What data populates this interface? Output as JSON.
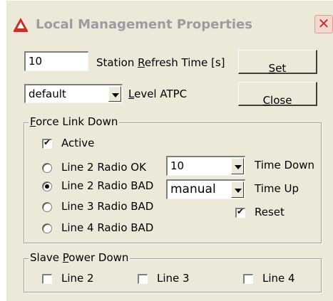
{
  "window": {
    "title": "Local Management Properties",
    "close_glyph": "✕"
  },
  "refresh": {
    "value": "10",
    "label_pre": "Station ",
    "label_u": "R",
    "label_post": "efresh Time [s]"
  },
  "level": {
    "value": "default",
    "label_u": "L",
    "label_post": "evel ATPC"
  },
  "buttons": {
    "set_u": "S",
    "set_post": "et",
    "close_u": "C",
    "close_post": "lose"
  },
  "force_link": {
    "legend_u": "F",
    "legend_post": "orce Link Down",
    "active_label": "Active",
    "radios": [
      "Line 2 Radio OK",
      "Line 2 Radio BAD",
      "Line 3 Radio BAD",
      "Line 4 Radio BAD"
    ],
    "time_down_value": "10",
    "time_down_label": "Time Down",
    "time_up_value": "manual",
    "time_up_label": "Time Up",
    "reset_label": "Reset"
  },
  "slave_power": {
    "legend_pre": "Slave ",
    "legend_u": "P",
    "legend_post": "ower Down",
    "lines": [
      "Line 2",
      "Line 3",
      "Line 4"
    ]
  },
  "colors": {
    "dialog_bg": "#ece9d8",
    "title_text": "#9c9ba3",
    "close_red": "#c8302a"
  }
}
